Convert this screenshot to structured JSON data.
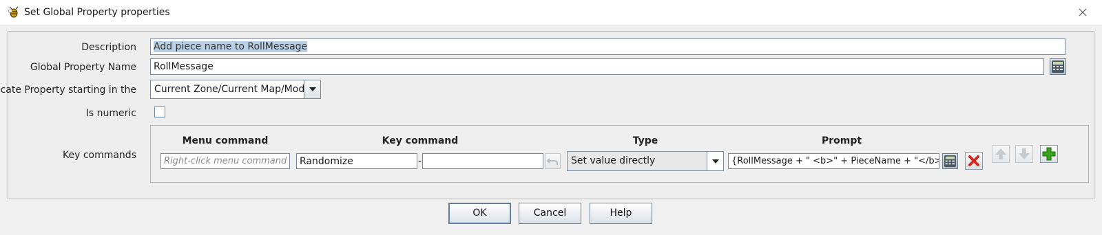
{
  "window": {
    "title": "Set Global Property properties"
  },
  "form": {
    "description_label": "Description",
    "description_value": "Add piece name to RollMessage",
    "property_name_label": "Global Property Name",
    "property_name_value": "RollMessage",
    "locate_label": "Locate Property starting in the",
    "locate_value": "Current Zone/Current Map/Module",
    "numeric_label": "Is numeric",
    "numeric_checked": false,
    "key_commands_label": "Key commands"
  },
  "key_commands": {
    "headers": {
      "menu": "Menu command",
      "key": "Key command",
      "type": "Type",
      "prompt": "Prompt"
    },
    "row": {
      "menu_placeholder": "Right-click menu command",
      "menu_value": "",
      "key_name": "Randomize",
      "key_separator": "-",
      "key_value": "",
      "type_value": "Set value directly",
      "prompt_value": "{RollMessage + \" <b>\" + PieceName + \"</b>\"}"
    }
  },
  "buttons": {
    "ok": "OK",
    "cancel": "Cancel",
    "help": "Help"
  },
  "icons": [
    "app-icon",
    "close-icon",
    "calculator-icon",
    "dropdown-arrow-icon",
    "undo-icon",
    "delete-icon",
    "move-up-icon",
    "move-down-icon",
    "add-icon"
  ],
  "colors": {
    "selection": "#b8cfe5",
    "delete": "#d62a1f",
    "add": "#3aa41f"
  }
}
